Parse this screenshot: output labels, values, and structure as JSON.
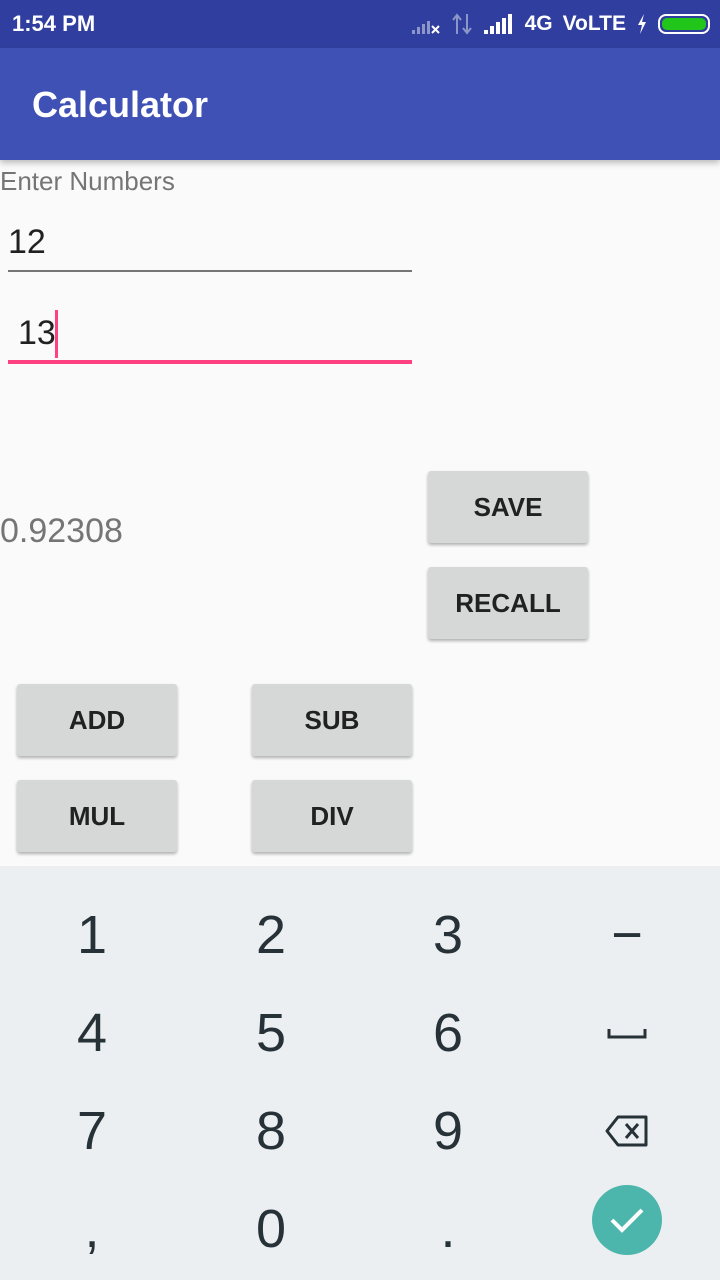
{
  "status_bar": {
    "time": "1:54 PM",
    "network": "4G",
    "volte": "VoLTE"
  },
  "app_bar": {
    "title": "Calculator"
  },
  "form": {
    "label": "Enter Numbers",
    "field1_value": "12",
    "field2_value": "13",
    "result": "0.92308"
  },
  "buttons": {
    "save": "SAVE",
    "recall": "RECALL",
    "add": "ADD",
    "sub": "SUB",
    "mul": "MUL",
    "div": "DIV"
  },
  "keyboard": {
    "k1": "1",
    "k2": "2",
    "k3": "3",
    "minus": "−",
    "k4": "4",
    "k5": "5",
    "k6": "6",
    "k7": "7",
    "k8": "8",
    "k9": "9",
    "comma": ",",
    "k0": "0",
    "dot": "."
  },
  "colors": {
    "status_bar": "#303f9f",
    "app_bar": "#3f51b5",
    "accent": "#ff4081",
    "confirm": "#4db6ac"
  }
}
